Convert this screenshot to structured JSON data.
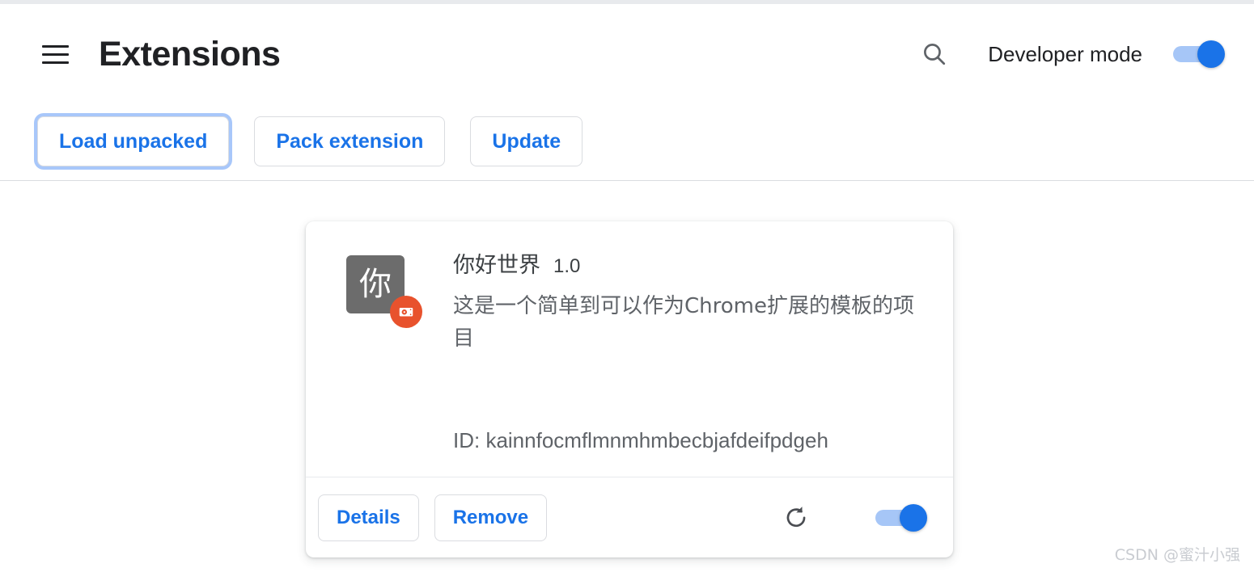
{
  "window": {
    "page_title": "Extensions"
  },
  "toolbar": {
    "menu_icon": "hamburger-menu-icon",
    "search_icon": "search-icon",
    "developer_mode_label": "Developer mode",
    "developer_mode_enabled": "on",
    "buttons": [
      {
        "label": "Load unpacked",
        "focused": "true"
      },
      {
        "label": "Pack extension",
        "focused": "false"
      },
      {
        "label": "Update",
        "focused": "false"
      }
    ]
  },
  "extension": {
    "icon_glyph": "你",
    "icon_bg": "#6c6c6c",
    "unpacked_badge_color": "#e8522d",
    "unpacked_badge_icon": "unpacked-extension-icon",
    "name": "你好世界",
    "version": "1.0",
    "description": "这是一个简单到可以作为Chrome扩展的模板的项目",
    "id_text": "ID: kainnfocmflmnmhmbecbjafdeifpdgeh",
    "details_label": "Details",
    "remove_label": "Remove",
    "reload_icon": "reload-icon",
    "enabled_toggle": "on"
  },
  "watermark": {
    "text": "CSDN @蜜汁小强"
  },
  "colors": {
    "accent_blue": "#1a73e8",
    "toggle_track": "#a6c6f7",
    "border_gray": "#dadce0",
    "text_primary": "#202124",
    "text_secondary": "#5f6368",
    "orange_badge": "#e8522d"
  }
}
